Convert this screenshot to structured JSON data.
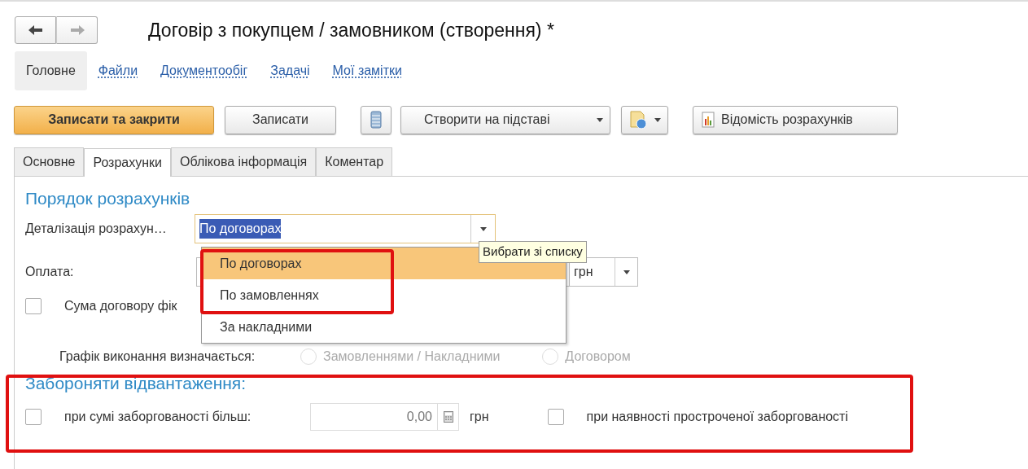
{
  "nav_buttons": [
    {
      "kind": "back",
      "disabled": false
    },
    {
      "kind": "forward",
      "disabled": true
    }
  ],
  "window": {
    "title": "Договір з покупцем / замовником (створення) *"
  },
  "sections": [
    {
      "label": "Головне",
      "selected": true
    },
    {
      "label": "Файли",
      "selected": false
    },
    {
      "label": "Документообіг",
      "selected": false
    },
    {
      "label": "Задачі",
      "selected": false
    },
    {
      "label": "Мої замітки",
      "selected": false
    }
  ],
  "toolbar": [
    {
      "kind": "primary",
      "label": "Записати та закрити"
    },
    {
      "kind": "plain",
      "label": "Записати"
    },
    {
      "kind": "list"
    },
    {
      "kind": "dropdown",
      "label": "Створити на підставі"
    },
    {
      "kind": "doc-menu"
    },
    {
      "kind": "report",
      "label": "Відомість розрахунків"
    }
  ],
  "tabs": [
    {
      "label": "Основне",
      "selected": false
    },
    {
      "label": "Розрахунки",
      "selected": true
    },
    {
      "label": "Облікова інформація",
      "selected": false
    },
    {
      "label": "Коментар",
      "selected": false
    }
  ],
  "settlement": {
    "heading": "Порядок розрахунків",
    "detail_label": "Деталізація розрахун…",
    "detail_value": "По договорах",
    "payment_label": "Оплата:",
    "currency": "грн",
    "fixed_sum": {
      "label": "Сума договору фік",
      "checked": false
    },
    "schedule_label": "Графік виконання визначається:",
    "schedule_options": [
      {
        "label": "Замовленнями / Накладними",
        "selected": false,
        "disabled": true
      },
      {
        "label": "Договором",
        "selected": false,
        "disabled": true
      }
    ]
  },
  "dropdown": {
    "items": [
      {
        "label": "По договорах",
        "selected": true
      },
      {
        "label": "По замовленнях",
        "selected": false
      },
      {
        "label": "За накладними",
        "selected": false
      }
    ]
  },
  "tooltip": "Вибрати зі списку",
  "prohibit": {
    "heading": "Забороняти відвантаження:",
    "debt": {
      "label": "при сумі заборгованості більш:",
      "checked": false
    },
    "debt_value": "0,00",
    "debt_currency": "грн",
    "overdue": {
      "label": "при наявності простроченої заборгованості",
      "checked": false
    }
  }
}
